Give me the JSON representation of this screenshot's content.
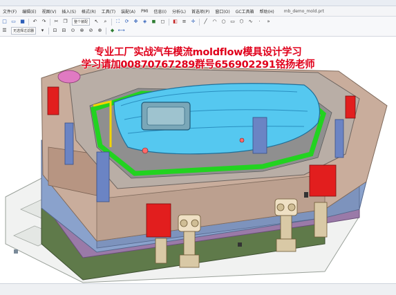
{
  "menu": {
    "items": [
      "文件(F)",
      "编辑(E)",
      "视图(V)",
      "插入(S)",
      "格式(R)",
      "工具(T)",
      "装配(A)",
      "PMI",
      "信息(I)",
      "分析(L)",
      "首选项(P)",
      "窗口(O)",
      "GC工具箱",
      "帮助(H)"
    ],
    "filename": "mb_demo_mold.prt"
  },
  "toolbar": {
    "filter_combo": "整个装配",
    "select_combo": "无选择过滤器"
  },
  "overlay": {
    "line1": "专业工厂实战汽车模流moldflow模具设计学习",
    "line2": "学习请加00870767289群号656902291铭扬老师"
  },
  "status": {
    "text": ""
  },
  "colors": {
    "plate_beige": "#c9ad9c",
    "plate_blue": "#8ea3c9",
    "part_cyan": "#4fd0ff",
    "runner_green": "#22d320",
    "slider_red": "#e21e1e",
    "yellow": "#f2d600"
  }
}
